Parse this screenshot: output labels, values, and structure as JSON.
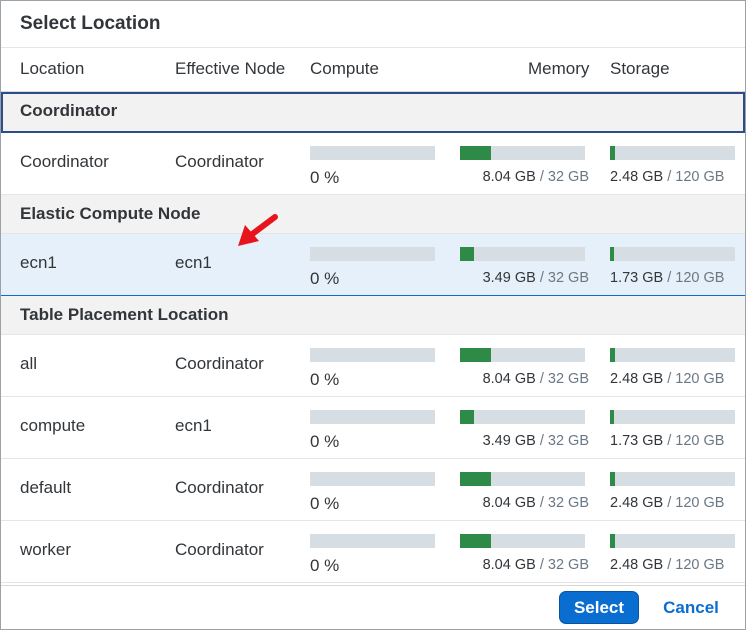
{
  "dialog": {
    "title": "Select Location"
  },
  "columns": {
    "location": "Location",
    "node": "Effective Node",
    "compute": "Compute",
    "memory": "Memory",
    "storage": "Storage"
  },
  "groups": [
    {
      "label": "Coordinator",
      "rows": [
        {
          "location": "Coordinator",
          "node": "Coordinator",
          "compute_pct": "0 %",
          "compute_level": 0,
          "memory_used": "8.04 GB",
          "memory_total": "/ 32 GB",
          "memory_level": 0.25,
          "storage_used": "2.48 GB",
          "storage_total": "/ 120 GB",
          "storage_level": 0.04
        }
      ]
    },
    {
      "label": "Elastic Compute Node",
      "rows": [
        {
          "location": "ecn1",
          "node": "ecn1",
          "compute_pct": "0 %",
          "compute_level": 0,
          "memory_used": "3.49 GB",
          "memory_total": "/ 32 GB",
          "memory_level": 0.11,
          "storage_used": "1.73 GB",
          "storage_total": "/ 120 GB",
          "storage_level": 0.03
        }
      ]
    },
    {
      "label": "Table Placement Location",
      "rows": [
        {
          "location": "all",
          "node": "Coordinator",
          "compute_pct": "0 %",
          "compute_level": 0,
          "memory_used": "8.04 GB",
          "memory_total": "/ 32 GB",
          "memory_level": 0.25,
          "storage_used": "2.48 GB",
          "storage_total": "/ 120 GB",
          "storage_level": 0.04
        },
        {
          "location": "compute",
          "node": "ecn1",
          "compute_pct": "0 %",
          "compute_level": 0,
          "memory_used": "3.49 GB",
          "memory_total": "/ 32 GB",
          "memory_level": 0.11,
          "storage_used": "1.73 GB",
          "storage_total": "/ 120 GB",
          "storage_level": 0.03
        },
        {
          "location": "default",
          "node": "Coordinator",
          "compute_pct": "0 %",
          "compute_level": 0,
          "memory_used": "8.04 GB",
          "memory_total": "/ 32 GB",
          "memory_level": 0.25,
          "storage_used": "2.48 GB",
          "storage_total": "/ 120 GB",
          "storage_level": 0.04
        },
        {
          "location": "worker",
          "node": "Coordinator",
          "compute_pct": "0 %",
          "compute_level": 0,
          "memory_used": "8.04 GB",
          "memory_total": "/ 32 GB",
          "memory_level": 0.25,
          "storage_used": "2.48 GB",
          "storage_total": "/ 120 GB",
          "storage_level": 0.04
        }
      ]
    }
  ],
  "footer": {
    "select_label": "Select",
    "cancel_label": "Cancel"
  },
  "colors": {
    "accent": "#0a6ed1",
    "bar_fill": "#2e8b47",
    "bar_track": "#d6dde3",
    "selected_row": "#e5f0fa",
    "annotation_arrow": "#e8141b"
  },
  "annotation": {
    "icon": "red-arrow-icon"
  }
}
